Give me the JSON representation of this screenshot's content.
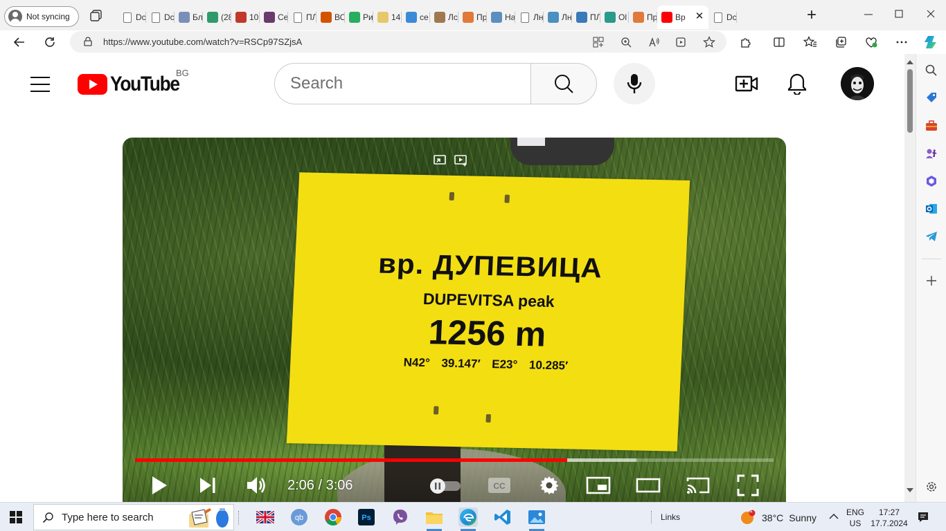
{
  "browser": {
    "profile_label": "Not syncing",
    "tabs": [
      {
        "label": "Dc",
        "icon": "document-icon",
        "kind": "doc"
      },
      {
        "label": "Dc",
        "icon": "document-icon",
        "kind": "doc"
      },
      {
        "label": "Бл",
        "icon": "blog-icon",
        "color": "#7a8fb8"
      },
      {
        "label": "(28",
        "icon": "home-icon",
        "color": "#2f9a6a"
      },
      {
        "label": "10",
        "icon": "pdf-icon",
        "color": "#c0392b"
      },
      {
        "label": "Се",
        "icon": "app-icon",
        "color": "#6a3a6a"
      },
      {
        "label": "ПЛ",
        "icon": "document-icon",
        "kind": "doc"
      },
      {
        "label": "ВС",
        "icon": "chart-icon",
        "color": "#d35400"
      },
      {
        "label": "Ри",
        "icon": "leaf-icon",
        "color": "#27ae60"
      },
      {
        "label": "14",
        "icon": "s-icon",
        "color": "#e6c86a"
      },
      {
        "label": "се",
        "icon": "maps-pin-icon",
        "color": "#3b8ad8"
      },
      {
        "label": "Лс",
        "icon": "photo-icon",
        "color": "#a07850"
      },
      {
        "label": "Пр",
        "icon": "c-icon",
        "color": "#e07a3a"
      },
      {
        "label": "На",
        "icon": "globe-icon",
        "color": "#5a8fc0"
      },
      {
        "label": "Лн",
        "icon": "document-icon",
        "kind": "doc"
      },
      {
        "label": "Лн",
        "icon": "snowflake-icon",
        "color": "#4a90c0"
      },
      {
        "label": "ПЛ",
        "icon": "chat-icon",
        "color": "#3a7ab8"
      },
      {
        "label": "Ol",
        "icon": "ol-icon",
        "color": "#2a9a8a"
      },
      {
        "label": "Пр",
        "icon": "c-icon",
        "color": "#e07a3a"
      },
      {
        "label": "Вр",
        "icon": "youtube-icon",
        "color": "#ff0000",
        "active": true
      },
      {
        "label": "Dc",
        "icon": "document-icon",
        "kind": "doc"
      }
    ],
    "url": "https://www.youtube.com/watch?v=RSCp97SZjsA"
  },
  "youtube": {
    "logo_text": "YouTube",
    "region": "BG",
    "search_placeholder": "Search"
  },
  "video": {
    "sign_title": "вр. ДУПЕВИЦА",
    "sign_subtitle": "DUPEVITSA peak",
    "sign_altitude": "1256 m",
    "sign_coords": "N42° 39.147′ E23° 10.285′",
    "current_time": "2:06",
    "duration": "3:06",
    "time_display": "2:06 / 3:06",
    "progress_fraction": 0.677,
    "buffered_fraction": 0.785
  },
  "taskbar": {
    "search_placeholder": "Type here to search",
    "links_label": "Links",
    "weather_temp": "38°C",
    "weather_desc": "Sunny",
    "weather_badge": "1",
    "lang_primary": "ENG",
    "lang_secondary": "US",
    "time": "17:27",
    "date": "17.7.2024"
  },
  "colors": {
    "youtube_red": "#ff0000",
    "sign_yellow": "#f3de12",
    "taskbar_bg": "#e9eef6"
  }
}
